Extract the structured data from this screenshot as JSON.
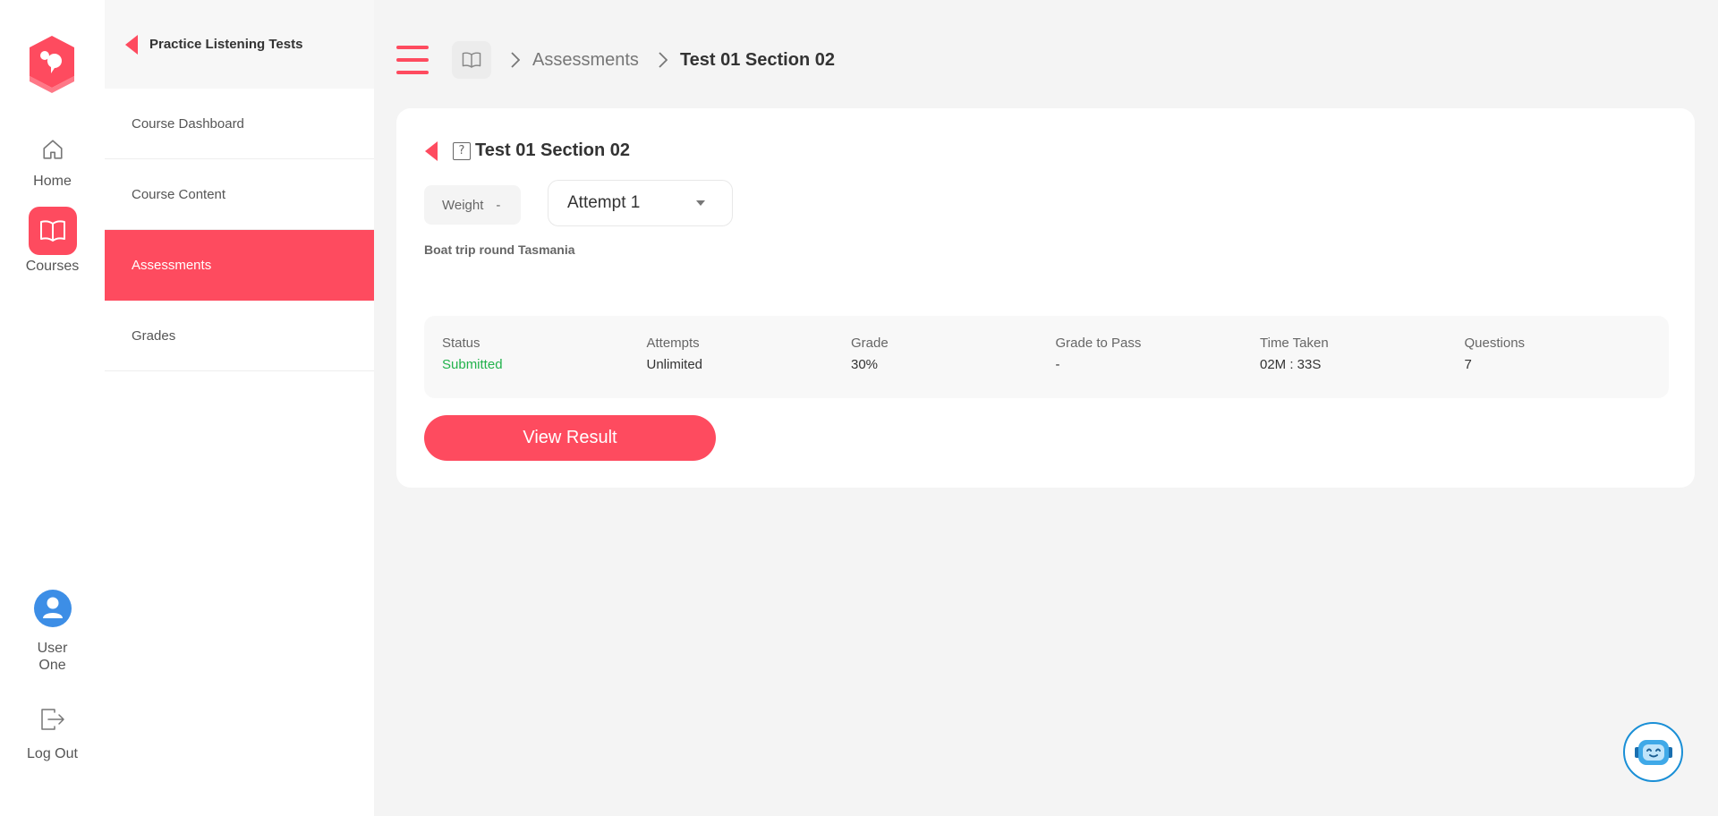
{
  "rail": {
    "items": [
      {
        "label": "Home",
        "icon": "home-icon"
      },
      {
        "label": "Courses",
        "icon": "book-icon"
      }
    ],
    "user": {
      "label_line1": "User",
      "label_line2": "One",
      "icon": "user-avatar-icon"
    },
    "logout": {
      "label": "Log Out",
      "icon": "logout-icon"
    }
  },
  "subnav": {
    "title": "Practice Listening Tests",
    "items": [
      {
        "label": "Course Dashboard"
      },
      {
        "label": "Course Content"
      },
      {
        "label": "Assessments"
      },
      {
        "label": "Grades"
      }
    ]
  },
  "breadcrumb": {
    "items": [
      "Assessments",
      "Test 01 Section 02"
    ]
  },
  "assessment": {
    "title": "Test 01 Section 02",
    "weight_label": "Weight",
    "weight_value": "-",
    "attempt_selected": "Attempt 1",
    "description": "Boat trip round Tasmania",
    "stats": [
      {
        "label": "Status",
        "value": "Submitted"
      },
      {
        "label": "Attempts",
        "value": "Unlimited"
      },
      {
        "label": "Grade",
        "value": "30%"
      },
      {
        "label": "Grade to Pass",
        "value": "-"
      },
      {
        "label": "Time Taken",
        "value": "02M : 33S"
      },
      {
        "label": "Questions",
        "value": "7"
      }
    ],
    "view_button": "View Result"
  },
  "colors": {
    "accent": "#fe4b5f",
    "success": "#22b24c",
    "background": "#f4f4f4",
    "chatbot_ring": "#1a8fd6"
  }
}
